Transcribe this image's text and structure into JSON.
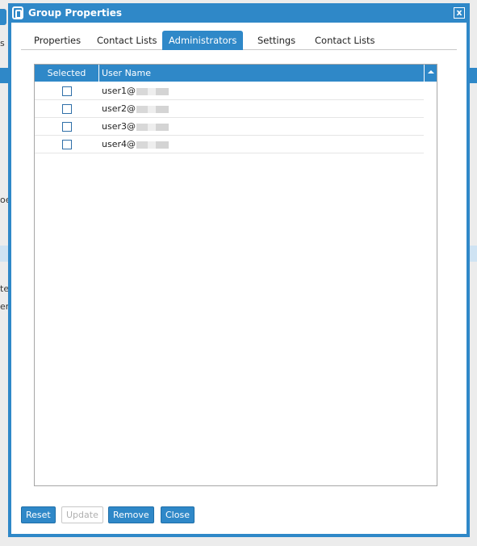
{
  "dialog": {
    "title": "Group Properties",
    "close_label": "x"
  },
  "background": {
    "frag1": "s",
    "frag2": "s",
    "frag3": "oe",
    "frag4": "te",
    "frag5": "er"
  },
  "tabs": [
    {
      "label": "Properties",
      "active": false
    },
    {
      "label": "Contact Lists",
      "active": false
    },
    {
      "label": "Administrators",
      "active": true
    },
    {
      "label": "Settings",
      "active": false
    },
    {
      "label": "Contact Lists",
      "active": false
    }
  ],
  "grid": {
    "columns": {
      "selected": "Selected",
      "user_name": "User Name"
    },
    "rows": [
      {
        "user": "user1@",
        "selected": false
      },
      {
        "user": "user2@",
        "selected": false
      },
      {
        "user": "user3@",
        "selected": false
      },
      {
        "user": "user4@",
        "selected": false
      }
    ]
  },
  "buttons": {
    "reset": "Reset",
    "update": "Update",
    "remove": "Remove",
    "close": "Close"
  },
  "colors": {
    "accent": "#2f88c8",
    "disabled_text": "#b0b0b0"
  },
  "icons": {
    "app_logo": "app-logo-icon",
    "close": "close-icon",
    "sort": "sort-up-icon",
    "checkbox": "checkbox-icon"
  }
}
